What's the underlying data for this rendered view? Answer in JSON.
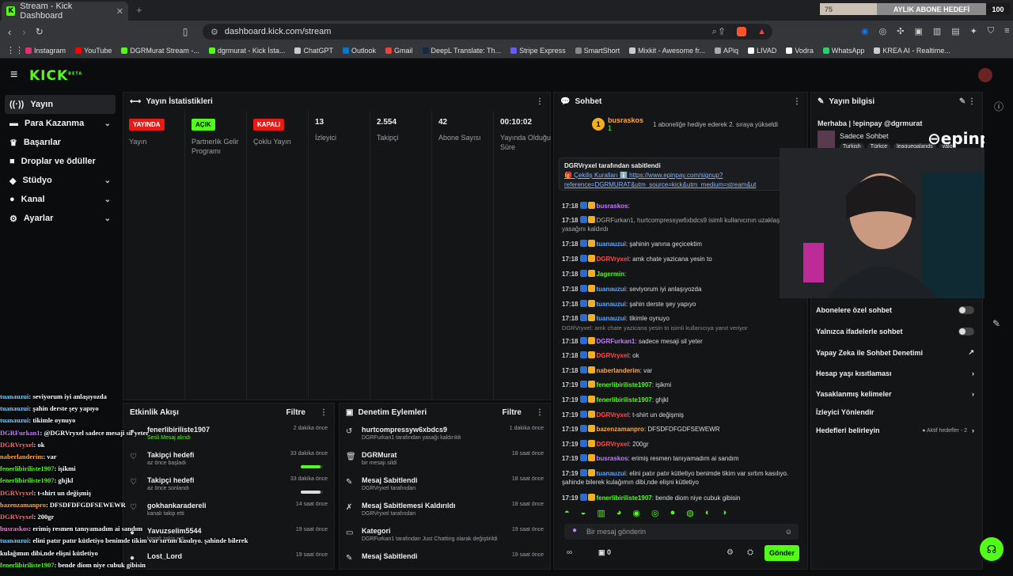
{
  "browser": {
    "tab_title": "Stream - Kick Dashboard",
    "url": "dashboard.kick.com/stream",
    "new_tab": "+"
  },
  "goal": {
    "progress": "75",
    "label": "AYLIK ABONE HEDEFİ",
    "target": "100",
    "fraction": 0.75
  },
  "bookmarks": [
    "Instagram",
    "YouTube",
    "DGRMurat Stream -...",
    "dgrmurat - Kick İsta...",
    "ChatGPT",
    "Outlook",
    "Gmail",
    "DeepL Translate: Th...",
    "Stripe Express",
    "SmartShort",
    "Mixkit - Awesome fr...",
    "APiq",
    "LIVAD",
    "Vodra",
    "WhatsApp",
    "KREA AI - Realtime..."
  ],
  "nav": {
    "logo": "KICK",
    "logo_sup": "BETA"
  },
  "sidebar": [
    {
      "label": "Yayın"
    },
    {
      "label": "Para Kazanma"
    },
    {
      "label": "Başarılar"
    },
    {
      "label": "Droplar ve ödüller"
    },
    {
      "label": "Stüdyo"
    },
    {
      "label": "Kanal"
    },
    {
      "label": "Ayarlar"
    }
  ],
  "stats": {
    "title": "Yayın İstatistikleri",
    "cols": [
      {
        "badge": "YAYINDA",
        "label": "Yayın"
      },
      {
        "badge": "AÇIK",
        "label": "Partnerlik Gelir Programı"
      },
      {
        "badge": "KAPALI",
        "label": "Çoklu Yayın"
      },
      {
        "value": "13",
        "label": "İzleyici"
      },
      {
        "value": "2.554",
        "label": "Takipçi"
      },
      {
        "value": "42",
        "label": "Abone Sayısı"
      },
      {
        "value": "00:10:02",
        "label": "Yayında Olduğu Süre"
      }
    ]
  },
  "activity": {
    "title": "Etkinlik Akışı",
    "filter": "Filtre",
    "items": [
      {
        "title": "fenerlibiriliste1907",
        "sub": "Sesli Mesaj alındı",
        "when": "2 dakika önce"
      },
      {
        "title": "Takipçi hedefi",
        "sub": "az önce başladı",
        "when": "33 dakika önce",
        "progress": 0.9
      },
      {
        "title": "Takipçi hedefi",
        "sub": "az önce sonlandı",
        "when": "33 dakika önce",
        "progress": 0.9
      },
      {
        "title": "gokhankaradereli",
        "sub": "kanalı takip etti",
        "when": "14 saat önce"
      },
      {
        "title": "Yavuzselim5544",
        "sub": "kanalı takip etti",
        "when": "19 saat önce"
      },
      {
        "title": "Lost_Lord",
        "sub": "",
        "when": "19 saat önce"
      }
    ]
  },
  "moderation": {
    "title": "Denetim Eylemleri",
    "filter": "Filtre",
    "items": [
      {
        "title": "hurtcompressyw6xbdcs9",
        "sub": "DGRFurkan1 tarafından yasağı kaldırıldı",
        "when": "1 dakika önce"
      },
      {
        "title": "DGRMurat",
        "sub": "bir mesajı sildi",
        "when": "18 saat önce"
      },
      {
        "title": "Mesaj Sabitlendi",
        "sub": "DGRVryxel tarafından",
        "when": "18 saat önce"
      },
      {
        "title": "Mesaj Sabitlemesi Kaldırıldı",
        "sub": "DGRVryxel tarafından",
        "when": "18 saat önce"
      },
      {
        "title": "Kategori",
        "sub": "DGRFurkan1 tarafından Just Chatting olarak değiştirildi",
        "when": "19 saat önce"
      },
      {
        "title": "Mesaj Sabitlendi",
        "sub": "",
        "when": "19 saat önce"
      }
    ]
  },
  "chat": {
    "title": "Sohbet",
    "gift_user": "busraskos",
    "gift_count": "1",
    "gift_text": "1 aboneliğe hediye ederek 2. sıraya yükseldi",
    "pinned_by": "DGRVryxel tarafından sabitlendi",
    "pinned_text": "🎁 Çekiliş Kuralları ℹ️ https://www.epinpay.com/signup?reference=DGRMURAT&utm_source=kick&utm_medium=stream&ut",
    "messages": [
      {
        "ts": "17:18",
        "user": "busraskos",
        "cls": "u-purple",
        "text": ""
      },
      {
        "ts": "17:18",
        "user": "",
        "cls": "",
        "text": "DGRFurkan1, hurtcompressyw6xbdcs9 isimli kullanıcının uzaklaştırma yasağını kaldırdı"
      },
      {
        "ts": "17:18",
        "user": "tuanauzui",
        "cls": "u-blue",
        "text": "şahinin yanına geçicektim"
      },
      {
        "ts": "17:18",
        "user": "DGRVryxel",
        "cls": "u-red",
        "text": "amk chate yazicana yesin to"
      },
      {
        "ts": "17:18",
        "user": "Jagermin",
        "cls": "u-green",
        "text": ""
      },
      {
        "ts": "17:18",
        "user": "tuanauzui",
        "cls": "u-blue",
        "text": "seviyorum iyi anlaşıyozda"
      },
      {
        "ts": "17:18",
        "user": "tuanauzui",
        "cls": "u-blue",
        "text": "şahin derste şey yapıyo"
      },
      {
        "ts": "17:18",
        "user": "tuanauzui",
        "cls": "u-blue",
        "text": "tikimle oynuyo"
      },
      {
        "ts": "17:18",
        "user": "DGRFurkan1",
        "cls": "u-purple",
        "text": "sadece mesaji sil yeter"
      },
      {
        "ts": "17:18",
        "user": "DGRVryxel",
        "cls": "u-red",
        "text": "ok"
      },
      {
        "ts": "17:18",
        "user": "naberlanderim",
        "cls": "u-orange",
        "text": "var"
      },
      {
        "ts": "17:19",
        "user": "fenerlibiriliste1907",
        "cls": "u-green",
        "text": "işikmi"
      },
      {
        "ts": "17:19",
        "user": "fenerlibiriliste1907",
        "cls": "u-green",
        "text": "ghjkl"
      },
      {
        "ts": "17:19",
        "user": "DGRVryxel",
        "cls": "u-red",
        "text": "t-shirt un değişmiş"
      },
      {
        "ts": "17:19",
        "user": "bazenzamanpro",
        "cls": "u-orange",
        "text": "DFSDFDFGDFSEWEWR"
      },
      {
        "ts": "17:19",
        "user": "DGRVryxel",
        "cls": "u-red",
        "text": "200gr"
      },
      {
        "ts": "17:19",
        "user": "busraskos",
        "cls": "u-purple",
        "text": "erimiş resmen tanıyamadım ai sandım"
      },
      {
        "ts": "17:19",
        "user": "tuanauzui",
        "cls": "u-blue",
        "text": "elini patır patır kütletiyo benimde tikim var sırtım kasılıyo. şahinde bilerek kulağımın dibi,nde elişni kütletiyo"
      },
      {
        "ts": "17:19",
        "user": "fenerlibiriliste1907",
        "cls": "u-green",
        "text": "bende diom niye cubuk gibisin"
      }
    ],
    "reply_note": "DGRVryxel: amk chate yazicana yesin to isimli kullanıcıya yanıt veriyor",
    "input_placeholder": "Bir mesaj gönderin",
    "points": "0",
    "send_label": "Gönder"
  },
  "info": {
    "title": "Yayın bilgisi",
    "greeting": "Merhaba | !epinpay @dgrmurat",
    "mode": "Sadece Sohbet",
    "tags": [
      "Turkish",
      "Türkçe",
      "leaguegalands",
      "valo"
    ],
    "brand": "epinpay",
    "rows": [
      {
        "label": "Abonelere özel sohbet",
        "type": "toggle"
      },
      {
        "label": "Yalnızca ifadelerle sohbet",
        "type": "toggle"
      },
      {
        "label": "Yapay Zeka ile Sohbet Denetimi",
        "type": "link"
      },
      {
        "label": "Hesap yaşı kısıtlaması",
        "type": "chev"
      },
      {
        "label": "Yasaklanmış kelimeler",
        "type": "chev"
      },
      {
        "label": "İzleyici Yönlendir",
        "type": "none"
      },
      {
        "label": "Hedefleri belirleyin",
        "type": "chev",
        "extra": "Aktif hedefler - 2"
      }
    ]
  },
  "overlay": [
    "tuanauzui: seviyorum iyi anlaşıyozda",
    "tuanauzui: şahin derste şey yapıyo",
    "tuanauzui: tikimle oynuyo",
    "DGRFurkan1: @DGRVryxel sadece mesaji sil yeter",
    "DGRVryxel: ok",
    "naberlanderim: var",
    "fenerlibiriliste1907: işikmi",
    "fenerlibiriliste1907: ghjkl",
    "DGRVryxel: t-shirt un değişmiş",
    "bazenzamanpro: DFSDFDFGDFSEWEWR",
    "DGRVryxel: 200gr",
    "busraskos: erimiş resmen tanıyamadım ai sandım",
    "tuanauzui: elini patır patır kütletiyo benimde tikim var sırtım kasılıyo. şahinde bilerek",
    "kulağımın dibi,nde elişni kütletiyo",
    "fenerlibiriliste1907: bende diom niye cubuk gibisin"
  ],
  "colors": {
    "accent": "#53fc18",
    "live": "#e91916",
    "bg": "#0b0c0e",
    "panel": "#141517"
  }
}
